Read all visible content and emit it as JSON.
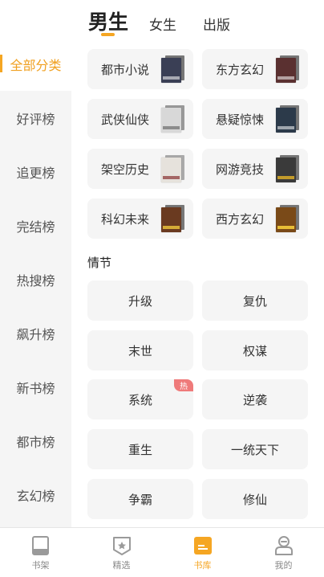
{
  "top_tabs": {
    "main": "男生",
    "female": "女生",
    "publish": "出版"
  },
  "sidebar": {
    "items": [
      {
        "label": "全部分类",
        "active": true
      },
      {
        "label": "好评榜"
      },
      {
        "label": "追更榜"
      },
      {
        "label": "完结榜"
      },
      {
        "label": "热搜榜"
      },
      {
        "label": "飙升榜"
      },
      {
        "label": "新书榜"
      },
      {
        "label": "都市榜"
      },
      {
        "label": "玄幻榜"
      }
    ]
  },
  "categories": [
    {
      "label": "都市小说",
      "cover_color": "#3a3f55"
    },
    {
      "label": "东方玄幻",
      "cover_color": "#5a3030"
    },
    {
      "label": "武侠仙侠",
      "cover_color": "#d8d8d8"
    },
    {
      "label": "悬疑惊悚",
      "cover_color": "#2c3a4a"
    },
    {
      "label": "架空历史",
      "cover_color": "#e6e2dc"
    },
    {
      "label": "网游竞技",
      "cover_color": "#3a3a3a"
    },
    {
      "label": "科幻未来",
      "cover_color": "#6a3a20"
    },
    {
      "label": "西方玄幻",
      "cover_color": "#7a4a18"
    }
  ],
  "plot_section": {
    "title": "情节",
    "items": [
      {
        "label": "升级"
      },
      {
        "label": "复仇"
      },
      {
        "label": "末世"
      },
      {
        "label": "权谋"
      },
      {
        "label": "系统",
        "badge": "热"
      },
      {
        "label": "逆袭"
      },
      {
        "label": "重生"
      },
      {
        "label": "一统天下"
      },
      {
        "label": "争霸"
      },
      {
        "label": "修仙"
      }
    ]
  },
  "bottom_nav": {
    "items": [
      {
        "label": "书架",
        "icon": "bookshelf-icon"
      },
      {
        "label": "精选",
        "icon": "featured-icon"
      },
      {
        "label": "书库",
        "icon": "library-icon",
        "active": true
      },
      {
        "label": "我的",
        "icon": "profile-icon"
      }
    ]
  },
  "colors": {
    "accent": "#f5a623",
    "sidebar_bg": "#f5f5f5",
    "card_bg": "#f5f5f5",
    "hot_badge": "#ef7a7a"
  }
}
